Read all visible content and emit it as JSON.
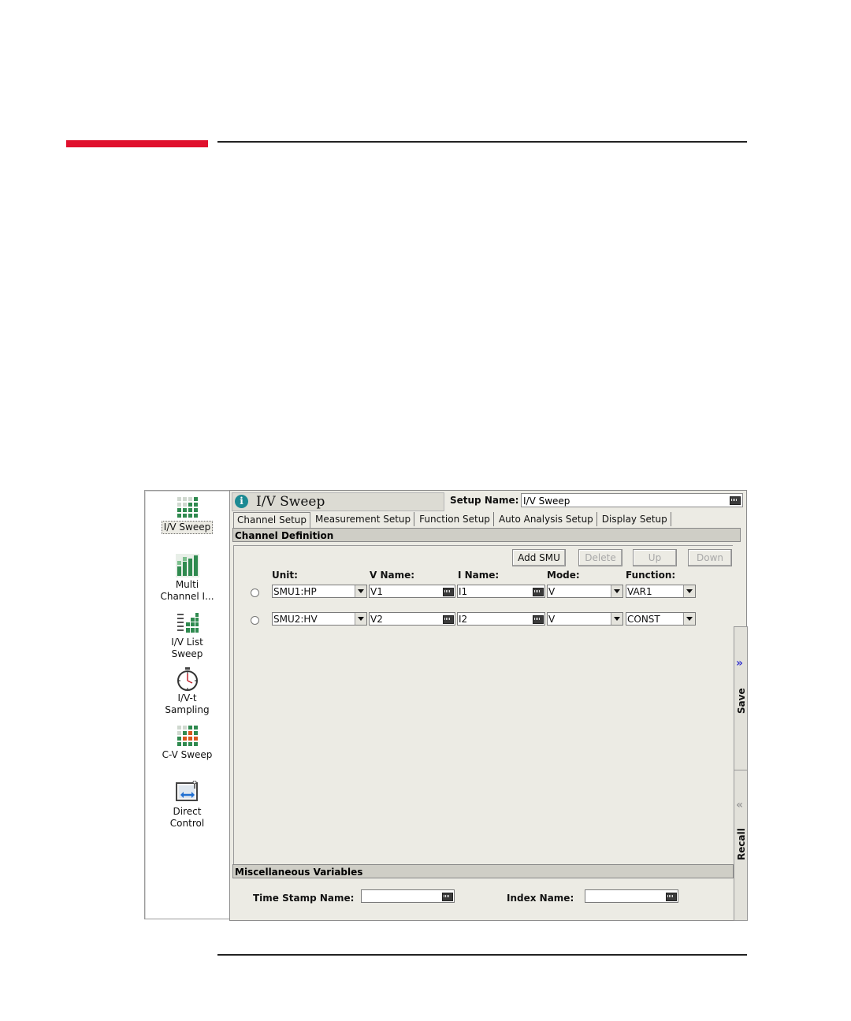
{
  "palette": {
    "items": [
      {
        "label_1": "I/V Sweep",
        "label_2": ""
      },
      {
        "label_1": "Multi",
        "label_2": "Channel I..."
      },
      {
        "label_1": "I/V List",
        "label_2": "Sweep"
      },
      {
        "label_1": "I/V-t",
        "label_2": "Sampling"
      },
      {
        "label_1": "C-V Sweep",
        "label_2": ""
      },
      {
        "label_1": "Direct",
        "label_2": "Control"
      }
    ]
  },
  "header": {
    "info_glyph": "i",
    "title": "I/V Sweep",
    "setup_name_label": "Setup Name:",
    "setup_name_value": "I/V Sweep"
  },
  "tabs": [
    "Channel Setup",
    "Measurement Setup",
    "Function Setup",
    "Auto Analysis Setup",
    "Display Setup"
  ],
  "channel_definition": {
    "title": "Channel Definition",
    "buttons": {
      "add": "Add SMU",
      "delete": "Delete",
      "up": "Up",
      "down": "Down"
    },
    "columns": {
      "unit": "Unit:",
      "vname": "V Name:",
      "iname": "I Name:",
      "mode": "Mode:",
      "function": "Function:"
    },
    "rows": [
      {
        "unit": "SMU1:HP",
        "vname": "V1",
        "iname": "I1",
        "mode": "V",
        "function": "VAR1"
      },
      {
        "unit": "SMU2:HV",
        "vname": "V2",
        "iname": "I2",
        "mode": "V",
        "function": "CONST"
      }
    ]
  },
  "misc": {
    "title": "Miscellaneous Variables",
    "timestamp_label": "Time Stamp Name:",
    "timestamp_value": "",
    "index_label": "Index Name:",
    "index_value": ""
  },
  "side": {
    "save": "Save",
    "recall": "Recall",
    "save_chev": "»",
    "recall_chev": "«"
  },
  "colors": {
    "accent_bar": "#e0102d",
    "window_bg": "#ecebe4",
    "info_icon": "#1c8a93"
  }
}
